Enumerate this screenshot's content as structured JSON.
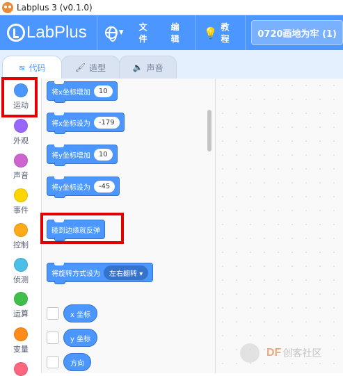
{
  "window": {
    "title": "Labplus 3 (v0.1.0)"
  },
  "menubar": {
    "brand": "LabPlus",
    "file_label": "文件",
    "edit_label": "编辑",
    "tutorial_label": "教程",
    "project_title": "0720画地为牢 (1)"
  },
  "tabs": [
    {
      "label": "代码",
      "icon": "code-icon",
      "active": true
    },
    {
      "label": "造型",
      "icon": "brush-icon",
      "active": false
    },
    {
      "label": "声音",
      "icon": "speaker-icon",
      "active": false
    }
  ],
  "categories": [
    {
      "label": "运动",
      "color": "#4c97ff"
    },
    {
      "label": "外观",
      "color": "#9966ff"
    },
    {
      "label": "声音",
      "color": "#cf63cf"
    },
    {
      "label": "事件",
      "color": "#ffd500"
    },
    {
      "label": "控制",
      "color": "#ffab19"
    },
    {
      "label": "侦测",
      "color": "#4cbfe6"
    },
    {
      "label": "运算",
      "color": "#40bf4a"
    },
    {
      "label": "变量",
      "color": "#ff8c1a"
    },
    {
      "label": "",
      "color": "#ff6680"
    }
  ],
  "blocks": {
    "change_x": {
      "label": "将x坐标增加",
      "value": "10"
    },
    "set_x": {
      "label": "将x坐标设为",
      "value": "-179"
    },
    "change_y": {
      "label": "将y坐标增加",
      "value": "10"
    },
    "set_y": {
      "label": "将y坐标设为",
      "value": "-45"
    },
    "bounce": {
      "label": "碰到边缘就反弹"
    },
    "rotation_style": {
      "label": "将旋转方式设为",
      "value": "左右翻转"
    }
  },
  "reporters": [
    {
      "label": "x 坐标"
    },
    {
      "label": "y 坐标"
    },
    {
      "label": "方向"
    }
  ],
  "watermark": {
    "df": "DF",
    "text": "创客社区"
  },
  "colors": {
    "accent": "#4c97ff",
    "highlight": "#e00000"
  }
}
